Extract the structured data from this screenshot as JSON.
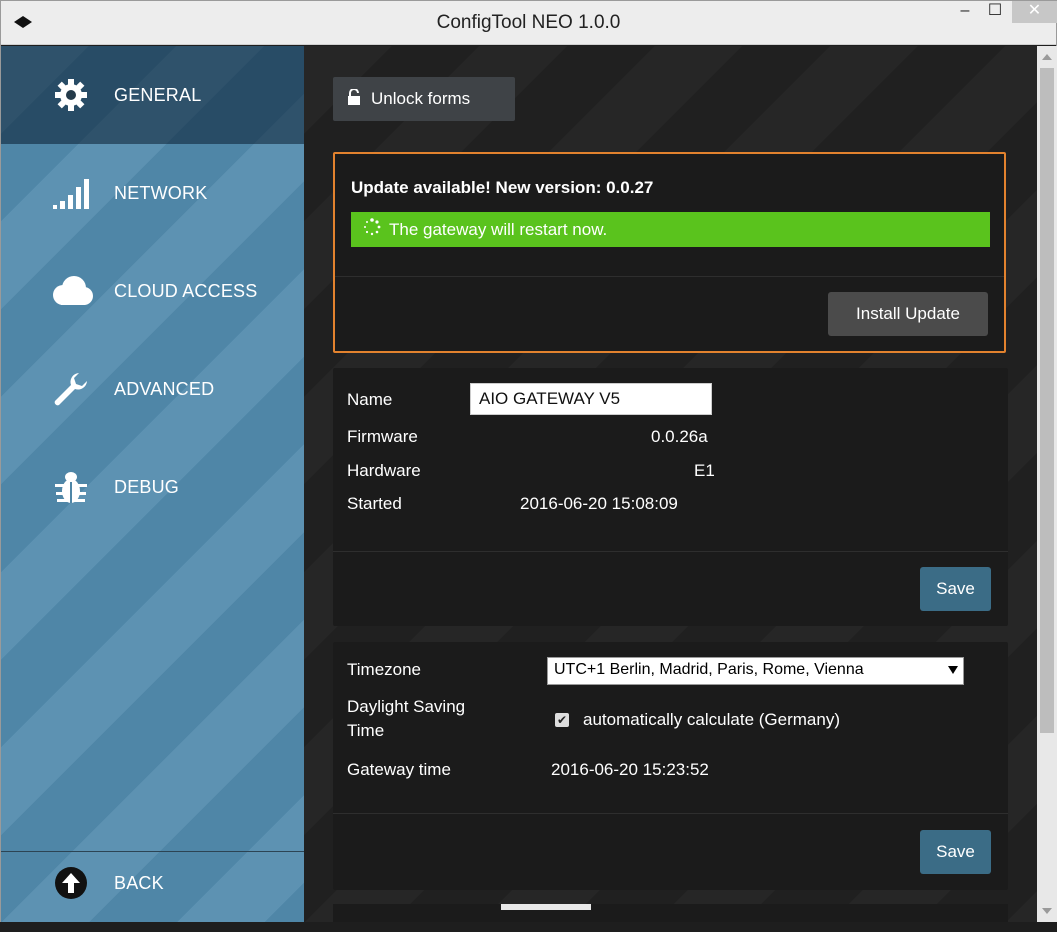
{
  "window": {
    "title": "ConfigTool NEO 1.0.0",
    "minimize_glyph": "‒",
    "maximize_glyph": "☐",
    "close_glyph": "✕"
  },
  "sidebar": {
    "items": [
      {
        "label": "GENERAL",
        "icon": "gear-icon",
        "active": true
      },
      {
        "label": "NETWORK",
        "icon": "signal-bars-icon",
        "active": false
      },
      {
        "label": "CLOUD ACCESS",
        "icon": "cloud-icon",
        "active": false
      },
      {
        "label": "ADVANCED",
        "icon": "wrench-icon",
        "active": false
      },
      {
        "label": "DEBUG",
        "icon": "bug-icon",
        "active": false
      }
    ],
    "back_label": "BACK",
    "back_icon": "arrow-up-circle-icon"
  },
  "toolbar": {
    "unlock_label": "Unlock forms",
    "unlock_icon": "unlock-icon"
  },
  "update": {
    "title": "Update available! New version: 0.0.27",
    "status": "The gateway will restart now.",
    "status_color": "#5ac31d",
    "install_label": "Install Update",
    "border_color": "#e2822e"
  },
  "info": {
    "name_label": "Name",
    "name_value": "AIO GATEWAY V5",
    "firmware_label": "Firmware",
    "firmware_value": "0.0.26a",
    "hardware_label": "Hardware",
    "hardware_value": "E1",
    "started_label": "Started",
    "started_value": "2016-06-20 15:08:09",
    "save_label": "Save"
  },
  "time": {
    "timezone_label": "Timezone",
    "timezone_value": "UTC+1  Berlin, Madrid, Paris, Rome, Vienna",
    "dst_label_line1": "Daylight Saving",
    "dst_label_line2": "Time",
    "dst_checkbox_label": "automatically calculate (Germany)",
    "dst_checked": true,
    "gateway_time_label": "Gateway time",
    "gateway_time_value": "2016-06-20 15:23:52",
    "save_label": "Save"
  },
  "colors": {
    "sidebar_blue": "#5d92b2",
    "save_button_blue": "#3b6c86"
  }
}
